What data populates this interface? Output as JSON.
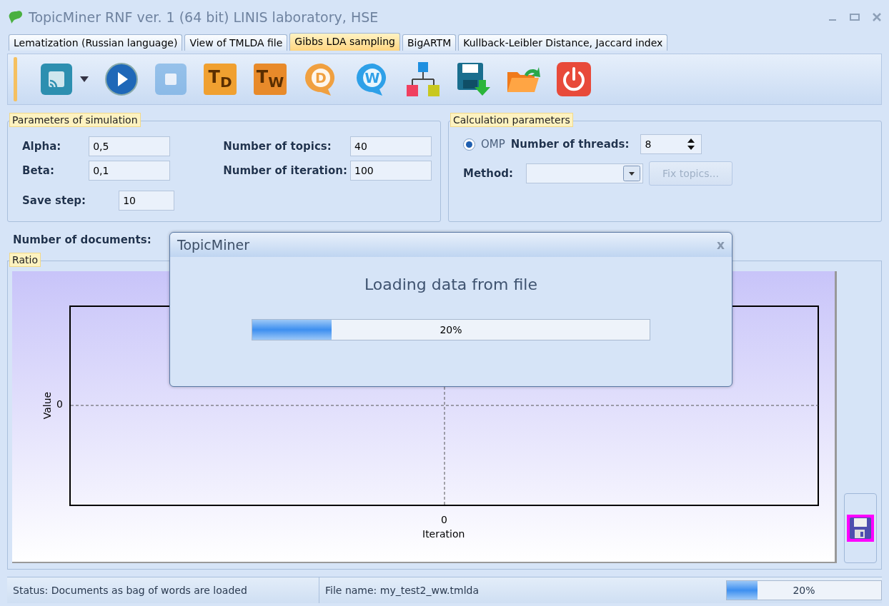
{
  "window": {
    "title": "TopicMiner RNF ver. 1 (64 bit) LINIS laboratory, HSE",
    "active": false
  },
  "tabs": [
    {
      "label": "Lematization (Russian language)",
      "selected": false
    },
    {
      "label": "View of TMLDA file",
      "selected": false
    },
    {
      "label": "Gibbs LDA sampling",
      "selected": true
    },
    {
      "label": "BigARTM",
      "selected": false
    },
    {
      "label": "Kullback-Leibler Distance, Jaccard index",
      "selected": false
    }
  ],
  "toolbar": [
    {
      "kind": "cast"
    },
    {
      "kind": "caret"
    },
    {
      "kind": "play"
    },
    {
      "kind": "stop",
      "disabled": true
    },
    {
      "kind": "tile",
      "text": "T$_{D}$",
      "color": "#f0a030"
    },
    {
      "kind": "tile",
      "text": "T$_{W}$",
      "color": "#e88a2a"
    },
    {
      "kind": "bubble",
      "text": "D",
      "color": "#f0a040"
    },
    {
      "kind": "bubble",
      "text": "W",
      "color": "#2ea0e8"
    },
    {
      "kind": "tree"
    },
    {
      "kind": "save"
    },
    {
      "kind": "open"
    },
    {
      "kind": "power"
    }
  ],
  "simulation": {
    "title": "Parameters of simulation",
    "fields": [
      {
        "label": "Alpha:",
        "value": "0,5"
      },
      {
        "label": "Beta:",
        "value": "0,1"
      },
      {
        "label": "Save step:",
        "value": "10"
      },
      {
        "label": "Number of topics:",
        "value": "40"
      },
      {
        "label": "Number of iteration:",
        "value": "100"
      }
    ]
  },
  "calculation": {
    "title": "Calculation parameters",
    "radio": {
      "label": "OMP",
      "selected": true
    },
    "threads": {
      "label": "Number of threads:",
      "value": "8"
    },
    "method": {
      "label": "Method:"
    },
    "fix_button": {
      "label": "Fix topics...",
      "disabled": true
    }
  },
  "documents_label": "Number of documents:",
  "ratio": {
    "title": "Ratio",
    "ylabel": "Value",
    "ytick": "0",
    "xtick": "0",
    "xlabel": "Iteration"
  },
  "dialog": {
    "title": "TopicMiner",
    "close": "x",
    "message": "Loading data from file",
    "level": 0.2,
    "reading": "20%"
  },
  "status_bar": {
    "status": "Status: Documents as bag of words are loaded",
    "file": "File name: my_test2_ww.tmlda",
    "level": 0.2,
    "reading": "20%"
  }
}
